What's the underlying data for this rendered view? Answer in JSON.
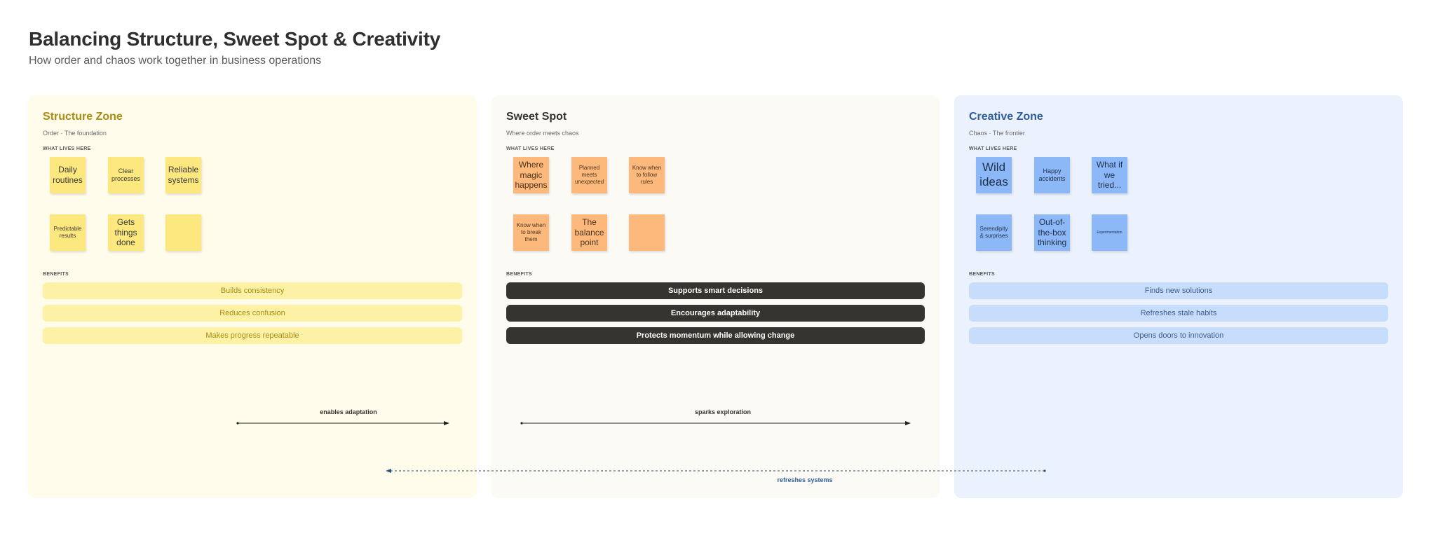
{
  "header": {
    "title": "Balancing Structure, Sweet Spot & Creativity",
    "subtitle": "How order and chaos work together in business operations"
  },
  "zones": [
    {
      "title": "Structure Zone",
      "subtitle": "Order · The foundation",
      "lives_label": "WHAT LIVES HERE",
      "notes": [
        "Daily routines",
        "Clear processes",
        "Reliable systems",
        "Predictable results",
        "Gets things done",
        ""
      ],
      "benefits_label": "BENEFITS",
      "benefits": [
        "Builds consistency",
        "Reduces confusion",
        "Makes progress repeatable"
      ]
    },
    {
      "title": "Sweet Spot",
      "subtitle": "Where order meets chaos",
      "lives_label": "WHAT LIVES HERE",
      "notes": [
        "Where magic happens",
        "Planned meets unexpected",
        "Know when to follow rules",
        "Know when to break them",
        "The balance point",
        ""
      ],
      "benefits_label": "BENEFITS",
      "benefits": [
        "Supports smart decisions",
        "Encourages adaptability",
        "Protects momentum while allowing change"
      ]
    },
    {
      "title": "Creative Zone",
      "subtitle": "Chaos · The frontier",
      "lives_label": "WHAT LIVES HERE",
      "notes": [
        "Wild ideas",
        "Happy accidents",
        "What if we tried...",
        "Serendipity & surprises",
        "Out-of-the-box thinking",
        "Experimentation"
      ],
      "benefits_label": "BENEFITS",
      "benefits": [
        "Finds new solutions",
        "Refreshes stale habits",
        "Opens doors to innovation"
      ]
    }
  ],
  "connectors": {
    "structure_to_sweet": "enables adaptation",
    "sweet_to_creative": "sparks exploration",
    "creative_to_structure": "refreshes systems"
  },
  "colors": {
    "structure_bg": "#fffceb",
    "structure_note": "#fde77f",
    "sweet_bg": "#fbfaf5",
    "sweet_note": "#fdb97b",
    "creative_bg": "#ebf2fd",
    "creative_note": "#8db8f8",
    "dark_pill": "#363431",
    "blue_accent": "#2f5d9c"
  }
}
